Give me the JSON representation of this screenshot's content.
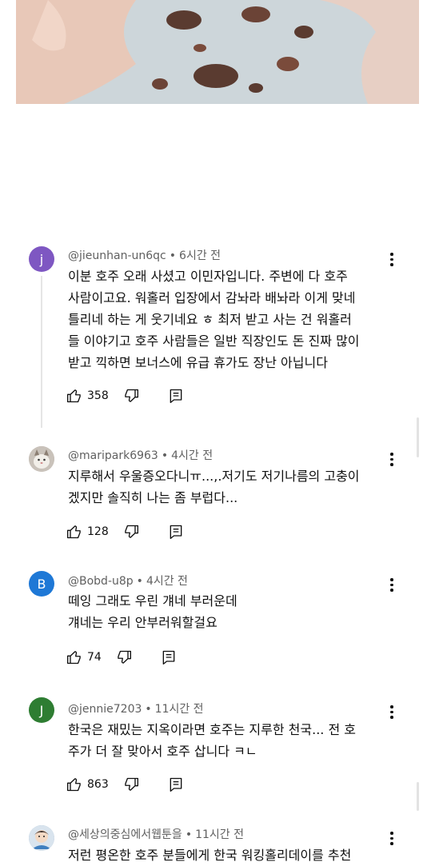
{
  "comments": [
    {
      "avatar_letter": "j",
      "avatar_color": "#7e57c2",
      "author": "@jieunhan-un6qc",
      "time": "6시간 전",
      "lines": [
        "이분 호주 오래 사셨고 이민자입니다. 주변에 다 호주",
        "사람이고요. 워홀러 입장에서 감놔라 배놔라 이게 맞네",
        "틀리네 하는 게 웃기네요 ㅎ 최저 받고 사는 건 워홀러",
        "들 이야기고 호주 사람들은 일반 직장인도 돈 진짜 많이",
        "받고 끽하면 보너스에 유급 휴가도 장난 아닙니다"
      ],
      "likes": "358"
    },
    {
      "avatar_letter": "",
      "avatar_color": "#b7b1aa",
      "author": "@maripark6963",
      "time": "4시간 전",
      "lines": [
        "지루해서 우울증오다니ㅠ...,.저기도 저기나름의 고충이",
        "겠지만 솔직히 나는 좀 부럽다..."
      ],
      "likes": "128"
    },
    {
      "avatar_letter": "B",
      "avatar_color": "#1e78d6",
      "author": "@Bobd-u8p",
      "time": "4시간 전",
      "lines": [
        "떼잉 그래도 우린 걔네 부러운데",
        "걔네는 우리 안부러워할걸요"
      ],
      "likes": "74"
    },
    {
      "avatar_letter": "J",
      "avatar_color": "#2e7d32",
      "author": "@jennie7203",
      "time": "11시간 전",
      "lines": [
        "한국은 재밌는 지옥이라면 호주는 지루한 천국...  전 호",
        "주가 더 잘 맞아서 호주 삽니다 ㅋㄴ"
      ],
      "likes": "863"
    },
    {
      "avatar_letter": "",
      "avatar_color": "#9fb8d0",
      "author": "@세상의중심에서웹툰을",
      "time": "11시간 전",
      "lines": [
        "저런 평온한 호주 분들에게 한국 워킹홀리데이를 추천"
      ],
      "likes": ""
    }
  ],
  "icons": {
    "like": "thumbs-up-icon",
    "dislike": "thumbs-down-icon",
    "reply": "reply-icon",
    "more": "more-vert-icon"
  }
}
